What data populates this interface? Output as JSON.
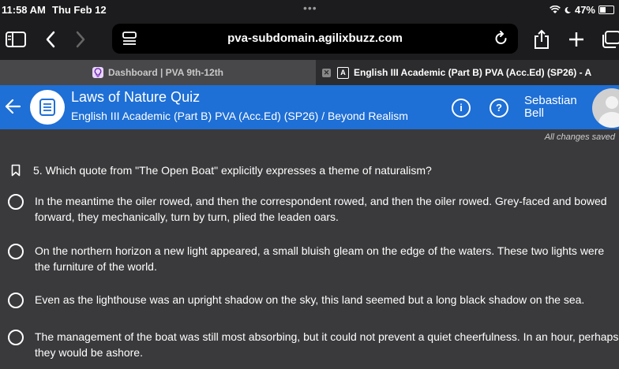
{
  "status": {
    "time": "11:58 AM",
    "date": "Thu Feb 12",
    "battery": "47%"
  },
  "browser": {
    "url": "pva-subdomain.agilixbuzz.com"
  },
  "tabs": [
    {
      "label": "Dashboard | PVA 9th-12th"
    },
    {
      "label": "English III Academic (Part B) PVA (Acc.Ed) (SP26) - A"
    }
  ],
  "header": {
    "quiz_title": "Laws of Nature Quiz",
    "course": "English III Academic (Part B) PVA (Acc.Ed) (SP26) / Beyond Realism",
    "user_first": "Sebastian",
    "user_last": "Bell"
  },
  "save_status": "All changes saved",
  "question": {
    "text": "5. Which quote from \"The Open Boat\" explicitly expresses a theme of naturalism?",
    "options": [
      "In the meantime the oiler rowed, and then the correspondent rowed, and then the oiler rowed. Grey-faced and bowed forward, they mechanically, turn by turn, plied the leaden oars.",
      "On the northern horizon a new light appeared, a small bluish gleam on the edge of the waters. These two lights were the furniture of the world.",
      "Even as the lighthouse was an upright shadow on the sky, this land seemed but a long black shadow on the sea.",
      "The management of the boat was still most absorbing, but it could not prevent a quiet cheerfulness. In an hour, perhaps they would be ashore."
    ]
  }
}
